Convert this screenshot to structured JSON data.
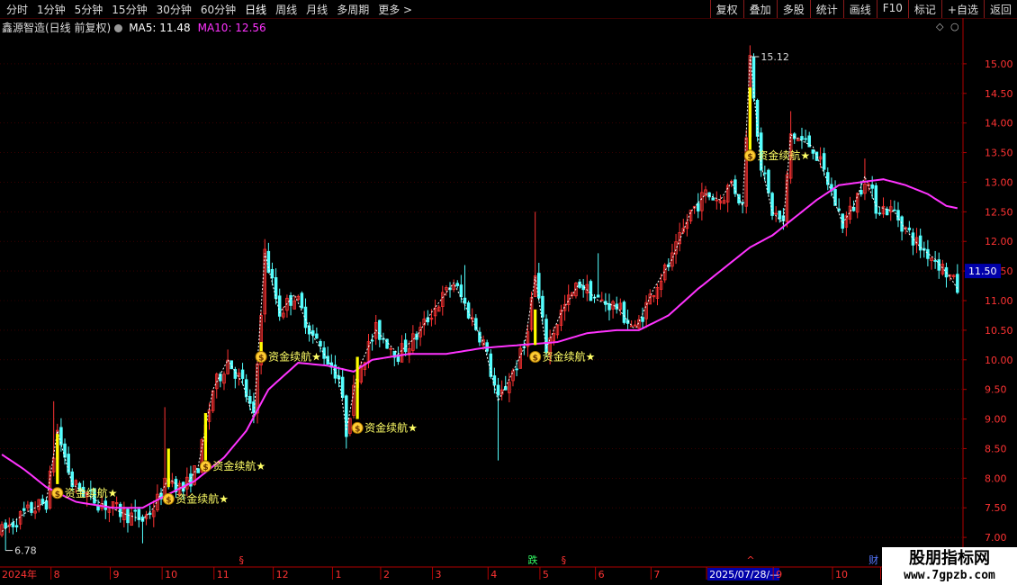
{
  "toolbar": {
    "periods": [
      "分时",
      "1分钟",
      "5分钟",
      "15分钟",
      "30分钟",
      "60分钟",
      "日线",
      "周线",
      "月线",
      "多周期",
      "更多 >"
    ],
    "active_period": "日线",
    "actions": [
      "复权",
      "叠加",
      "多股",
      "统计",
      "画线",
      "F10",
      "标记",
      "+自选",
      "返回"
    ]
  },
  "info": {
    "stock_label": "鑫源智造(日线 前复权)",
    "ma5": "MA5: 11.48",
    "ma10": "MA10: 12.56"
  },
  "colors": {
    "up": "#ff3333",
    "down": "#54ffff",
    "ma_line": "#ff33ff",
    "signal_bar": "#ffff00",
    "signal_text": "#ffff66",
    "axis": "#b00000",
    "grid": "#5a0000",
    "price_label": "#ff3333",
    "current_price_bg": "#0000aa"
  },
  "chart_data": {
    "type": "candlestick",
    "ylim": [
      6.5,
      15.5
    ],
    "y_ticks": [
      "7.00",
      "7.50",
      "8.00",
      "8.50",
      "9.00",
      "9.50",
      "10.00",
      "10.50",
      "11.00",
      "11.50",
      "12.00",
      "12.50",
      "13.00",
      "13.50",
      "14.00",
      "14.50",
      "15.00"
    ],
    "current_price": "11.50",
    "high_label": "15.12",
    "low_label": "6.78",
    "x_labels": [
      {
        "label": "2024年",
        "idx": 0
      },
      {
        "label": "8",
        "idx": 14
      },
      {
        "label": "9",
        "idx": 30
      },
      {
        "label": "10",
        "idx": 44
      },
      {
        "label": "11",
        "idx": 58
      },
      {
        "label": "12",
        "idx": 74
      },
      {
        "label": "1",
        "idx": 90
      },
      {
        "label": "2",
        "idx": 103
      },
      {
        "label": "3",
        "idx": 117
      },
      {
        "label": "4",
        "idx": 132
      },
      {
        "label": "5",
        "idx": 146
      },
      {
        "label": "6",
        "idx": 161
      },
      {
        "label": "7",
        "idx": 176
      },
      {
        "label": "2025/07/28/—",
        "idx": 191
      },
      {
        "label": "9",
        "idx": 209
      },
      {
        "label": "10",
        "idx": 225
      },
      {
        "label": "1",
        "idx": 238
      }
    ],
    "markers": [
      {
        "label": "§",
        "idx": 65,
        "color": "#ff3333"
      },
      {
        "label": "跌",
        "idx": 143,
        "color": "#33ff66"
      },
      {
        "label": "§",
        "idx": 152,
        "color": "#ff3333"
      },
      {
        "label": "^",
        "idx": 202,
        "color": "#ff3333"
      },
      {
        "label": "财",
        "idx": 235,
        "color": "#5577ff"
      }
    ],
    "pivots": [
      [
        0,
        7.1
      ],
      [
        6,
        7.4
      ],
      [
        12,
        7.6
      ],
      [
        15,
        8.8
      ],
      [
        19,
        7.9
      ],
      [
        26,
        7.6
      ],
      [
        33,
        7.4
      ],
      [
        38,
        7.3
      ],
      [
        41,
        7.5
      ],
      [
        45,
        8.0
      ],
      [
        49,
        7.8
      ],
      [
        53,
        8.2
      ],
      [
        57,
        9.5
      ],
      [
        61,
        10.0
      ],
      [
        65,
        9.6
      ],
      [
        68,
        9.0
      ],
      [
        71,
        11.8
      ],
      [
        75,
        10.8
      ],
      [
        79,
        11.1
      ],
      [
        84,
        10.4
      ],
      [
        88,
        10.0
      ],
      [
        91,
        9.7
      ],
      [
        93,
        8.8
      ],
      [
        96,
        9.8
      ],
      [
        101,
        10.5
      ],
      [
        107,
        10.1
      ],
      [
        112,
        10.4
      ],
      [
        116,
        10.8
      ],
      [
        122,
        11.3
      ],
      [
        126,
        10.8
      ],
      [
        130,
        10.3
      ],
      [
        134,
        9.3
      ],
      [
        138,
        9.8
      ],
      [
        141,
        10.2
      ],
      [
        144,
        11.4
      ],
      [
        147,
        10.2
      ],
      [
        151,
        10.8
      ],
      [
        156,
        11.3
      ],
      [
        161,
        11.0
      ],
      [
        166,
        10.9
      ],
      [
        171,
        10.5
      ],
      [
        176,
        11.2
      ],
      [
        181,
        11.7
      ],
      [
        186,
        12.5
      ],
      [
        190,
        12.8
      ],
      [
        194,
        12.7
      ],
      [
        197,
        13.0
      ],
      [
        200,
        12.6
      ],
      [
        202,
        15.12
      ],
      [
        205,
        13.3
      ],
      [
        208,
        12.5
      ],
      [
        211,
        12.3
      ],
      [
        213,
        13.8
      ],
      [
        216,
        13.7
      ],
      [
        219,
        13.6
      ],
      [
        223,
        13.0
      ],
      [
        227,
        12.3
      ],
      [
        230,
        12.6
      ],
      [
        233,
        13.1
      ],
      [
        236,
        12.6
      ],
      [
        241,
        12.5
      ],
      [
        244,
        12.2
      ],
      [
        248,
        11.9
      ],
      [
        252,
        11.7
      ],
      [
        256,
        11.4
      ],
      [
        258,
        11.2
      ]
    ],
    "ma_pivots": [
      [
        0,
        8.4
      ],
      [
        6,
        8.15
      ],
      [
        12,
        7.85
      ],
      [
        20,
        7.6
      ],
      [
        30,
        7.5
      ],
      [
        38,
        7.5
      ],
      [
        44,
        7.7
      ],
      [
        52,
        7.95
      ],
      [
        60,
        8.35
      ],
      [
        66,
        8.8
      ],
      [
        72,
        9.5
      ],
      [
        80,
        9.95
      ],
      [
        88,
        9.9
      ],
      [
        95,
        9.8
      ],
      [
        100,
        10.0
      ],
      [
        110,
        10.1
      ],
      [
        120,
        10.1
      ],
      [
        130,
        10.2
      ],
      [
        140,
        10.25
      ],
      [
        150,
        10.3
      ],
      [
        158,
        10.45
      ],
      [
        166,
        10.5
      ],
      [
        172,
        10.5
      ],
      [
        180,
        10.75
      ],
      [
        188,
        11.2
      ],
      [
        196,
        11.6
      ],
      [
        202,
        11.9
      ],
      [
        208,
        12.1
      ],
      [
        214,
        12.4
      ],
      [
        220,
        12.7
      ],
      [
        226,
        12.95
      ],
      [
        232,
        13.0
      ],
      [
        238,
        13.05
      ],
      [
        244,
        12.95
      ],
      [
        250,
        12.8
      ],
      [
        255,
        12.6
      ],
      [
        258,
        12.56
      ]
    ],
    "signals": [
      {
        "idx": 15,
        "bar_bottom": 7.9,
        "bar_top": 8.75,
        "icon_price": 7.75,
        "label": "资金续航★"
      },
      {
        "idx": 45,
        "bar_bottom": 7.85,
        "bar_top": 8.5,
        "icon_price": 7.65,
        "label": "资金续航★"
      },
      {
        "idx": 55,
        "bar_bottom": 8.3,
        "bar_top": 9.1,
        "icon_price": 8.2,
        "label": "资金续航★"
      },
      {
        "idx": 70,
        "bar_bottom": 10.1,
        "bar_top": 10.3,
        "icon_price": 10.05,
        "label": "资金续航★"
      },
      {
        "idx": 96,
        "bar_bottom": 9.0,
        "bar_top": 10.05,
        "icon_price": 8.85,
        "label": "资金续航★"
      },
      {
        "idx": 144,
        "bar_bottom": 10.25,
        "bar_top": 10.85,
        "icon_price": 10.05,
        "label": "资金续航★"
      },
      {
        "idx": 202,
        "bar_bottom": 13.55,
        "bar_top": 14.6,
        "icon_price": 13.45,
        "label": "资金续航★"
      }
    ]
  }
}
